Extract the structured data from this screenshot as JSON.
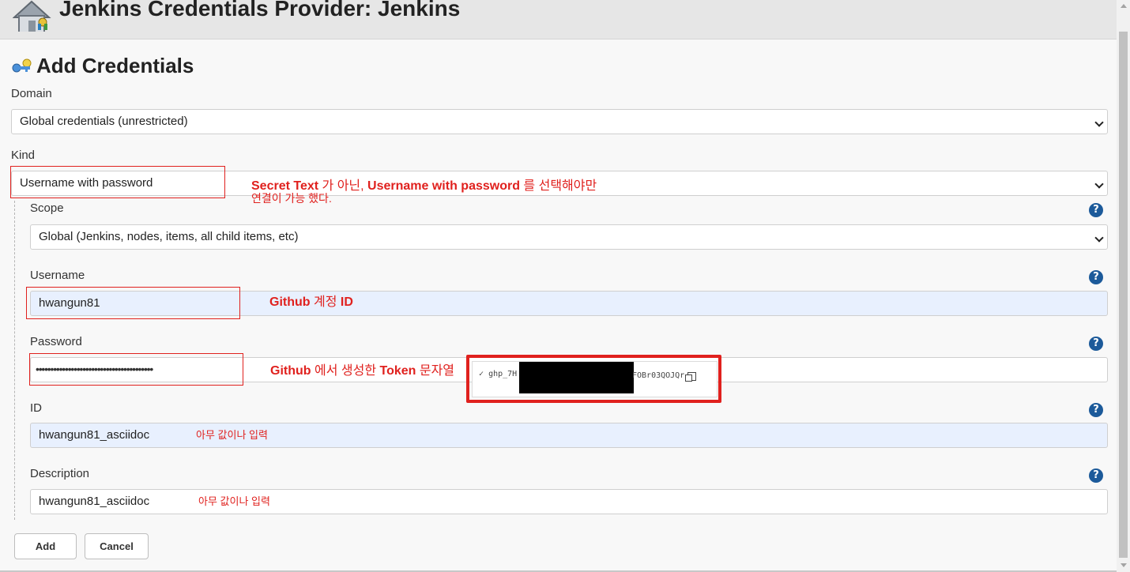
{
  "header": {
    "title": "Jenkins Credentials Provider: Jenkins",
    "icon": "house-icon"
  },
  "section": {
    "title": "Add Credentials",
    "icon": "keys-icon"
  },
  "form": {
    "domain": {
      "label": "Domain",
      "value": "Global credentials (unrestricted)"
    },
    "kind": {
      "label": "Kind",
      "value": "Username with password"
    },
    "scope": {
      "label": "Scope",
      "value": "Global (Jenkins, nodes, items, all child items, etc)"
    },
    "username": {
      "label": "Username",
      "value": "hwangun81"
    },
    "password": {
      "label": "Password",
      "value": "••••••••••••••••••••••••••••••••••••••••"
    },
    "id": {
      "label": "ID",
      "value": "hwangun81_asciidoc"
    },
    "description": {
      "label": "Description",
      "value": "hwangun81_asciidoc"
    },
    "help_symbol": "?"
  },
  "popup": {
    "check": "✓",
    "token_start": "ghp_7H",
    "token_end": "FOBr03QOJQr"
  },
  "annotations": {
    "kind_line1_a": "Secret Text",
    "kind_line1_b": " 가 아닌, ",
    "kind_line1_c": "Username with password",
    "kind_line1_d": " 를 선택해야만",
    "kind_line2": "연결이 가능 했다.",
    "username_a": "Github",
    "username_b": " 계정 ",
    "username_c": "ID",
    "password_a": "Github",
    "password_b": " 에서 생성한 ",
    "password_c": "Token",
    "password_d": " 문자열",
    "id": "아무 값이나 입력",
    "description": "아무 값이나 입력"
  },
  "buttons": {
    "add": "Add",
    "cancel": "Cancel"
  },
  "colors": {
    "annotation_red": "#e0211e",
    "help_blue": "#1c5a9a",
    "autofill": "#e8f0fe"
  }
}
